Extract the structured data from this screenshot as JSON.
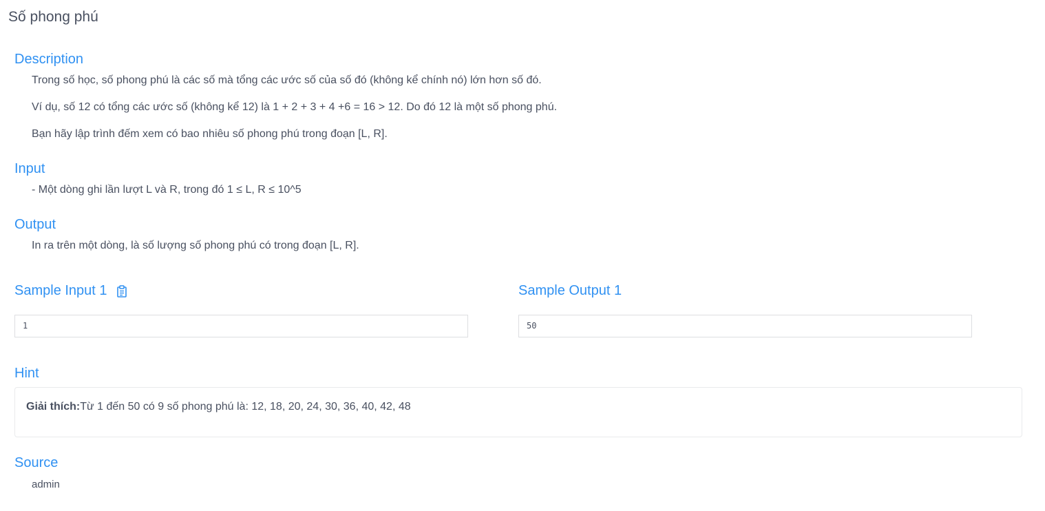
{
  "problem": {
    "title": "Số phong phú"
  },
  "description": {
    "heading": "Description",
    "paragraphs": [
      "Trong số học, số phong phú là các số mà tổng các ước số của số đó (không kể chính nó) lớn hơn số đó.",
      "Ví dụ, số 12 có tổng các ước số (không kể 12) là 1 + 2 + 3 + 4 +6 = 16 > 12. Do đó 12 là một số phong phú.",
      "Bạn hãy lập trình đếm xem có bao nhiêu số phong phú trong đoạn [L, R]."
    ]
  },
  "input": {
    "heading": "Input",
    "text": "- Một dòng ghi lần lượt L và R, trong đó 1 ≤ L, R ≤ 10^5"
  },
  "output": {
    "heading": "Output",
    "text": "In ra trên một dòng, là số lượng số phong phú có trong đoạn [L, R]."
  },
  "samples": {
    "input_heading": "Sample Input 1",
    "input_value": "1",
    "output_heading": "Sample Output 1",
    "output_value": "50",
    "copy_icon": "clipboard-icon"
  },
  "hint": {
    "heading": "Hint",
    "label": "Giải thích:",
    "text": "Từ 1 đến 50 có 9 số phong phú là: 12, 18, 20, 24, 30, 36, 40, 42, 48"
  },
  "source": {
    "heading": "Source",
    "text": "admin"
  },
  "colors": {
    "accent": "#3091f2",
    "text": "#495060",
    "border": "#dddee1"
  }
}
